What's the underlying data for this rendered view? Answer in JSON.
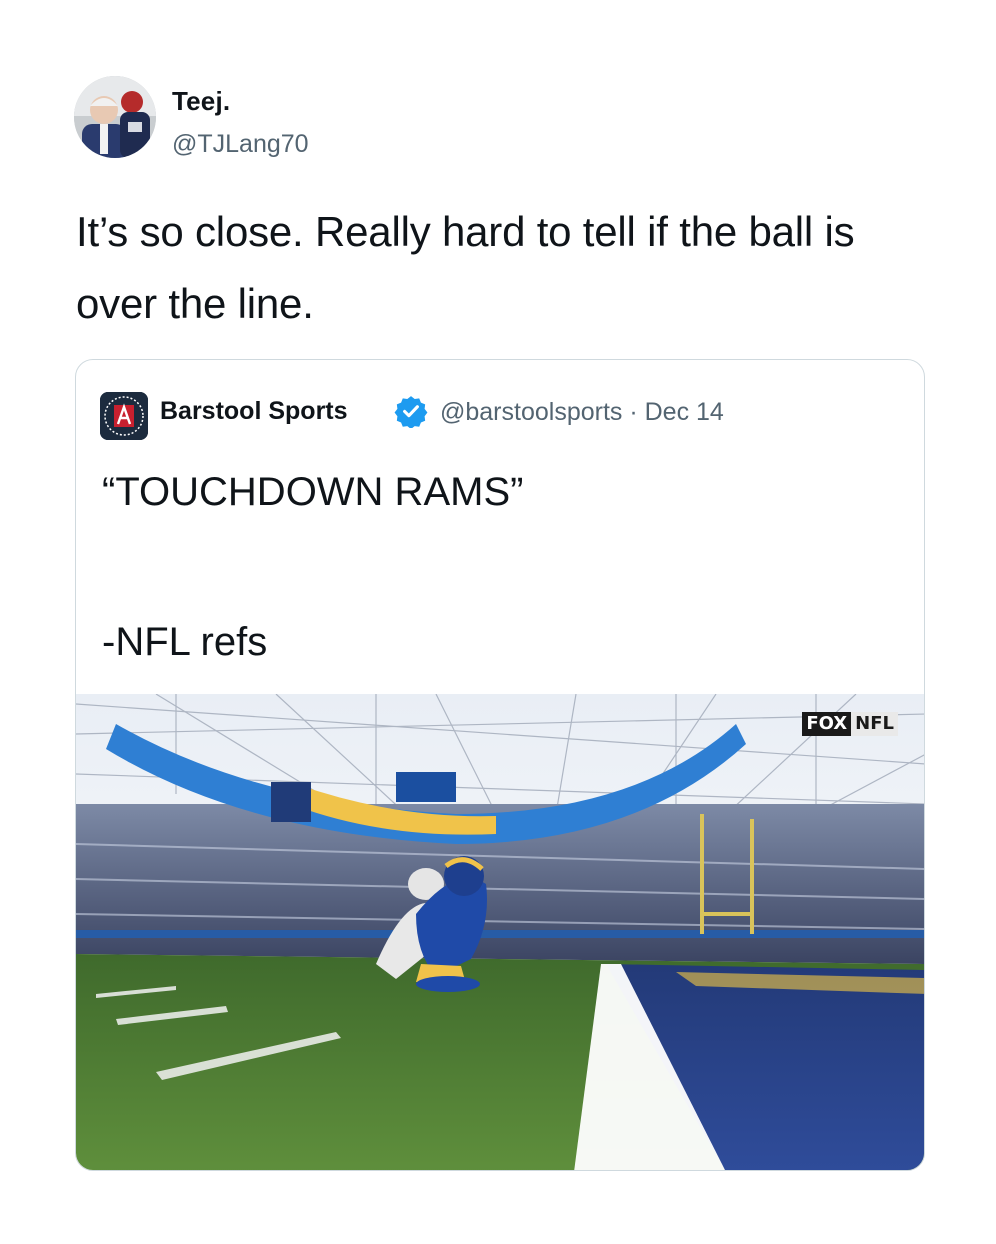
{
  "tweet": {
    "author_name": "Teej.",
    "author_handle": "@TJLang70",
    "text": "It’s so close. Really hard to tell if the ball is over the line.",
    "avatar_icon": "profile-photo"
  },
  "quoted_tweet": {
    "author_name": "Barstool Sports",
    "verified_icon": "verified-badge-icon",
    "handle_and_date": "@barstoolsports · Dec 14",
    "text_line1": "“TOUCHDOWN RAMS”",
    "text_line2": "-NFL refs",
    "media": {
      "description_icon": "stadium-photo",
      "broadcaster_fox": "FOX",
      "broadcaster_nfl": "NFL"
    }
  },
  "colors": {
    "text_primary": "#0f1419",
    "text_secondary": "#536471",
    "border": "#cfd9de",
    "verified_blue": "#1d9bf0"
  }
}
